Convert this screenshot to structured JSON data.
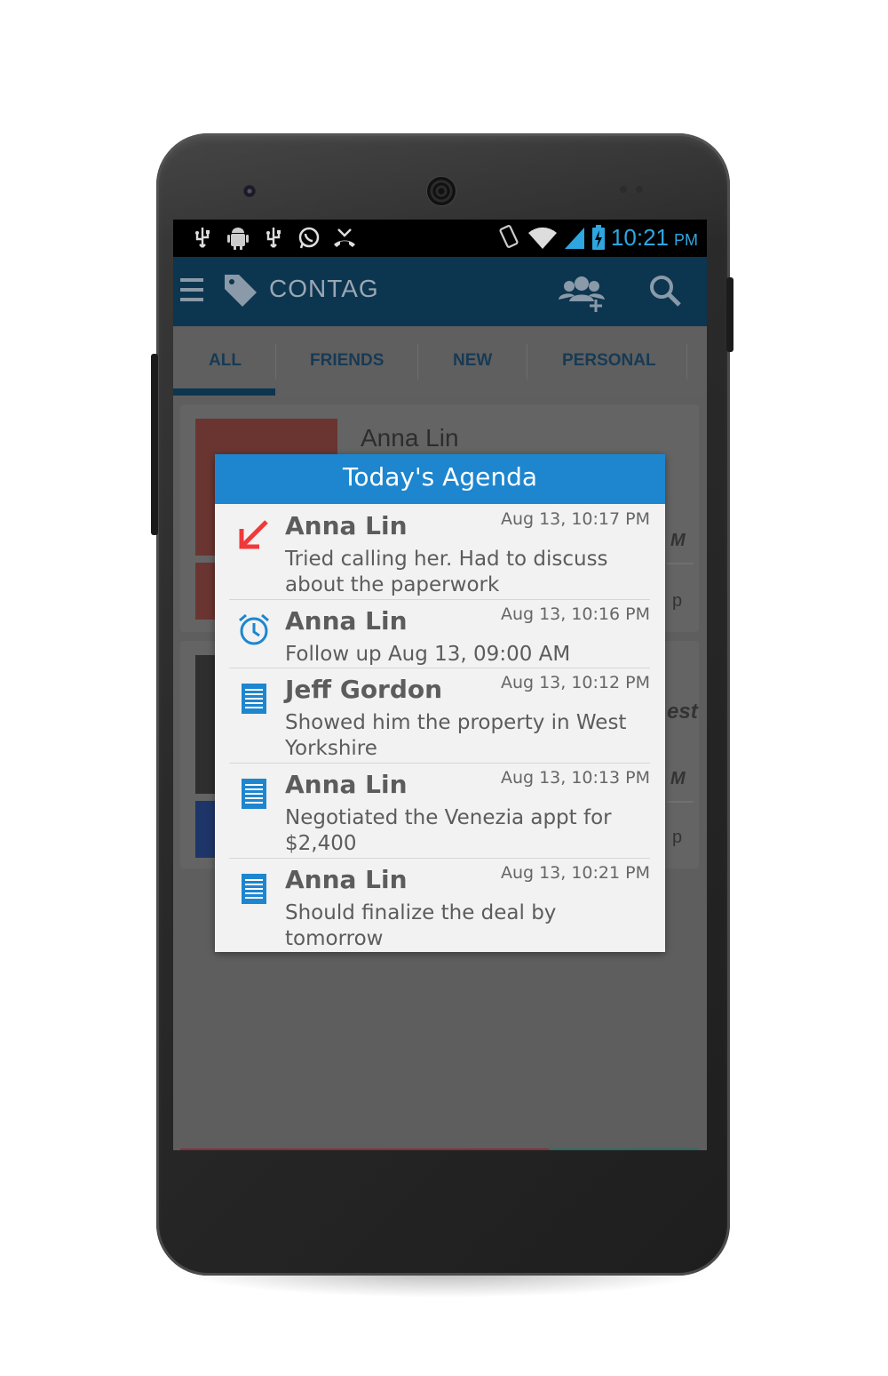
{
  "statusbar": {
    "time": "10:21",
    "ampm": "PM",
    "icons_left": [
      "usb-icon",
      "android-debug-icon",
      "usb-icon",
      "whatsapp-icon",
      "missed-call-icon"
    ],
    "icons_right": [
      "vibrate-icon",
      "wifi-icon",
      "signal-icon",
      "battery-icon"
    ]
  },
  "appbar": {
    "title": "CONTAG"
  },
  "tabs": [
    {
      "label": "ALL",
      "selected": true
    },
    {
      "label": "FRIENDS",
      "selected": false
    },
    {
      "label": "NEW",
      "selected": false
    },
    {
      "label": "PERSONAL",
      "selected": false
    }
  ],
  "background_cards": {
    "card1_name": "Anna Lin",
    "frag_m1": "M",
    "frag_p1": "p",
    "frag_west": "est",
    "frag_m2": "M",
    "frag_p2": "p"
  },
  "dialog": {
    "title": "Today's Agenda",
    "items": [
      {
        "icon": "missed-call-arrow-icon",
        "name": "Anna Lin",
        "time": "Aug 13, 10:17 PM",
        "text": "Tried calling her. Had to discuss about the paperwork"
      },
      {
        "icon": "alarm-clock-icon",
        "name": "Anna Lin",
        "time": "Aug 13, 10:16 PM",
        "text": "Follow up Aug 13, 09:00 AM"
      },
      {
        "icon": "note-icon",
        "name": "Jeff Gordon",
        "time": "Aug 13, 10:12 PM",
        "text": "Showed him the property in West Yorkshire"
      },
      {
        "icon": "note-icon",
        "name": "Anna Lin",
        "time": "Aug 13, 10:13 PM",
        "text": "Negotiated the Venezia appt for $2,400"
      },
      {
        "icon": "note-icon",
        "name": "Anna Lin",
        "time": "Aug 13, 10:21 PM",
        "text": "Should finalize the deal by tomorrow"
      }
    ]
  },
  "colors": {
    "appbar": "#0c3550",
    "dialog_header": "#1d86cf",
    "missed_call": "#f0393a",
    "icon_blue": "#1d86cf",
    "time_blue": "#2ea6e0"
  }
}
